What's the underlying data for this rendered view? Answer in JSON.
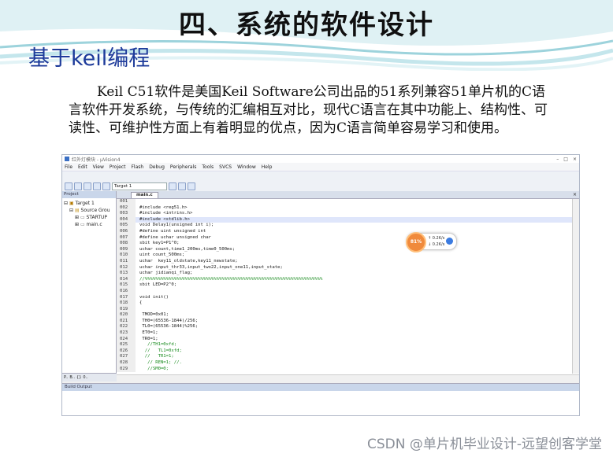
{
  "slide": {
    "title": "四、系统的软件设计",
    "subtitle": "基于keil编程",
    "paragraph": "Keil C51软件是美国Keil Software公司出品的51系列兼容51单片机的C语言软件开发系统，与传统的汇编相互对比，现代C语言在其中功能上、结构性、可读性、可维护性方面上有着明显的优点，因为C语言简单容易学习和使用。",
    "watermark": "CSDN @单片机毕业设计-远望创客学堂"
  },
  "window": {
    "title": "红外灯模块 - µVision4",
    "controls": [
      "–",
      "□",
      "×"
    ]
  },
  "menu": [
    "File",
    "Edit",
    "View",
    "Project",
    "Flash",
    "Debug",
    "Peripherals",
    "Tools",
    "SVCS",
    "Window",
    "Help"
  ],
  "toolbar": {
    "target": "Target 1"
  },
  "project_pane": {
    "header": "Project",
    "tree": [
      "Target 1",
      "Source Grou",
      "STARTUP",
      "main.c"
    ],
    "tabs": [
      "P..",
      "B..",
      "{}",
      "0.."
    ]
  },
  "editor": {
    "tab": "main.c",
    "lines": [
      {
        "n": "001",
        "t": ""
      },
      {
        "n": "002",
        "t": "#include <reg51.h>"
      },
      {
        "n": "003",
        "t": "#include <intrins.h>"
      },
      {
        "n": "004",
        "t": "#include <stdlib.h>"
      },
      {
        "n": "005",
        "t": "void Delay1(unsigned int i);"
      },
      {
        "n": "006",
        "t": "#define uint unsigned int"
      },
      {
        "n": "007",
        "t": "#define uchar unsigned char"
      },
      {
        "n": "008",
        "t": "sbit key1=P1^0;"
      },
      {
        "n": "009",
        "t": "uchar count,time1_200ms,time0_500ms;"
      },
      {
        "n": "010",
        "t": "uint count_500ms;"
      },
      {
        "n": "011",
        "t": "uchar  key11_oldstate,key11_newstate;"
      },
      {
        "n": "012",
        "t": "uchar input_thr33,input_two22,input_one11,input_state;"
      },
      {
        "n": "013",
        "t": "uchar jidianqi_flag;"
      },
      {
        "n": "014",
        "t": "//%%%%%%%%%%%%%%%%%%%%%%%%%%%%%%%%%%%%%%%%%%%%%%%%%%%%%%%%%%%%%%%%%%%"
      },
      {
        "n": "015",
        "t": "sbit LED=P2^0;"
      },
      {
        "n": "016",
        "t": ""
      },
      {
        "n": "017",
        "t": "void init()"
      },
      {
        "n": "018",
        "t": "{"
      },
      {
        "n": "019",
        "t": ""
      },
      {
        "n": "020",
        "t": " TMOD=0x01;"
      },
      {
        "n": "021",
        "t": " TH0=(65536-1844)/256;"
      },
      {
        "n": "022",
        "t": " TL0=(65536-1844)%256;"
      },
      {
        "n": "023",
        "t": " ET0=1;"
      },
      {
        "n": "024",
        "t": " TR0=1;"
      },
      {
        "n": "025",
        "t": "   //TH1=0xfd;"
      },
      {
        "n": "026",
        "t": "  //   TL1=0xfd;"
      },
      {
        "n": "027",
        "t": "  //   TR1=1;"
      },
      {
        "n": "028",
        "t": "   // REN=1; //."
      },
      {
        "n": "029",
        "t": "   //SM0=0;"
      }
    ]
  },
  "build": {
    "header": "Build Output"
  },
  "net_widget": {
    "percent": "81%",
    "up": "0.2K/s",
    "down": "0.2K/s"
  }
}
